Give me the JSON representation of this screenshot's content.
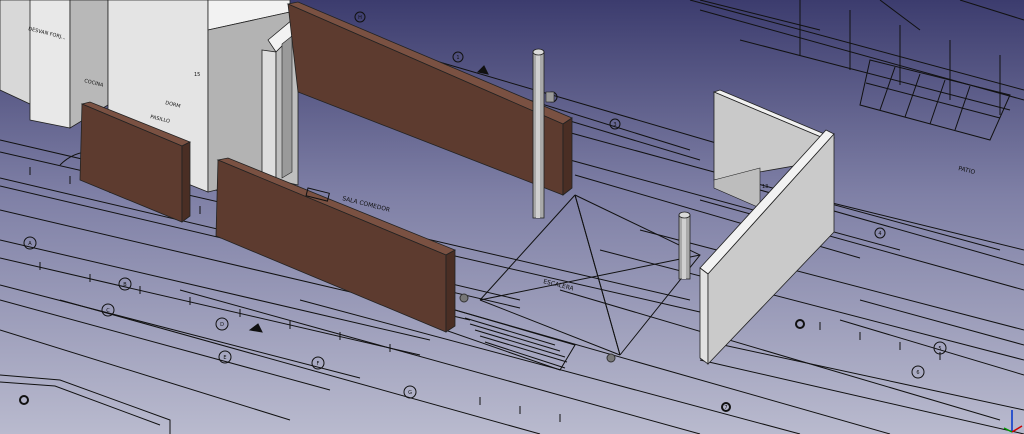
{
  "viewport": {
    "name": "FreeCAD 3D view",
    "background_top": "#3c3c6e",
    "background_bottom": "#b9bace"
  },
  "labels": {
    "room_a": "DESVAN FORJ...",
    "room_b": "DORM",
    "room_c": "PASILLO",
    "room_d": "COCINA",
    "corridor": "SALA COMEDOR",
    "hall": "ESCALERA",
    "terrace": "PATIO",
    "tag_13": "13",
    "tag_15": "15"
  },
  "grid_markers": [
    "A",
    "B",
    "C",
    "D",
    "E",
    "F",
    "G",
    "H",
    "1",
    "2",
    "3",
    "4",
    "5",
    "6",
    "7"
  ],
  "colors": {
    "wall_light": "#e6e6e6",
    "wall_shade": "#b4b4b4",
    "wall_brown": "#5d3b2f",
    "wall_brown_top": "#7a5142",
    "column": "#a9a9a9",
    "line": "#111111"
  }
}
